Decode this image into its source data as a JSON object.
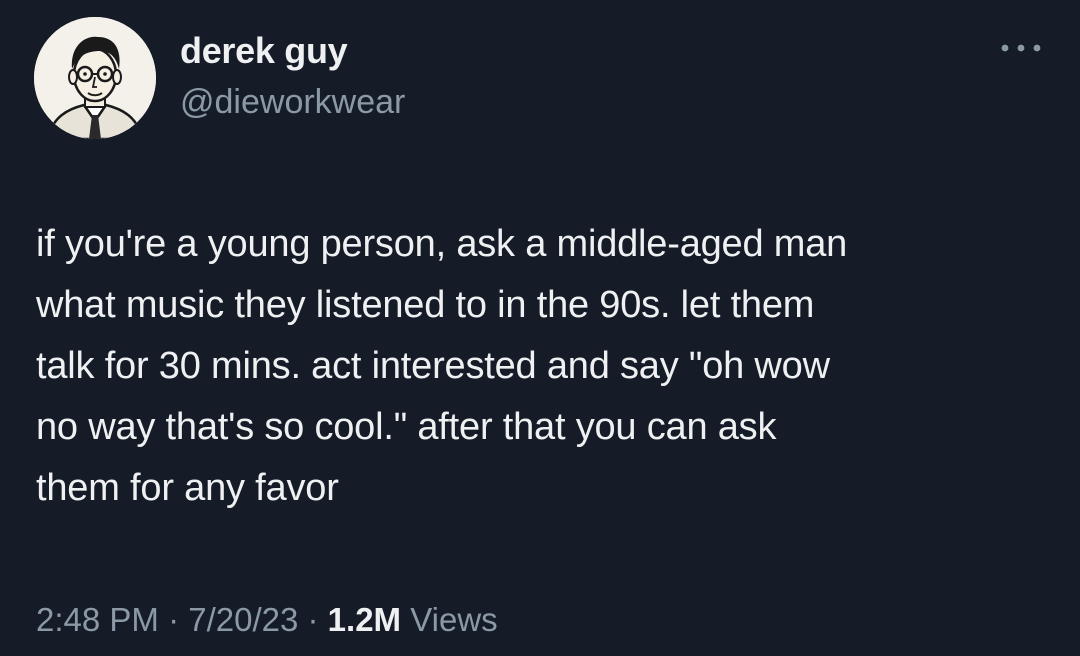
{
  "user": {
    "display_name": "derek guy",
    "handle": "@dieworkwear",
    "avatar_icon": "illustrated-portrait-avatar"
  },
  "menu": {
    "icon": "more-options-icon"
  },
  "tweet": {
    "text": "if you're a young person, ask a middle-aged man\nwhat music they listened to in the 90s. let them\ntalk for 30 mins. act interested and say \"oh wow\nno way that's so cool.\" after that you can ask\nthem for any favor"
  },
  "meta": {
    "time": "2:48 PM",
    "sep1": " · ",
    "date": "7/20/23",
    "sep2": " · ",
    "views_count": "1.2M",
    "views_label": " Views"
  },
  "colors": {
    "background": "#151c28",
    "text": "#eef0f1",
    "secondary": "#8b98a5"
  }
}
